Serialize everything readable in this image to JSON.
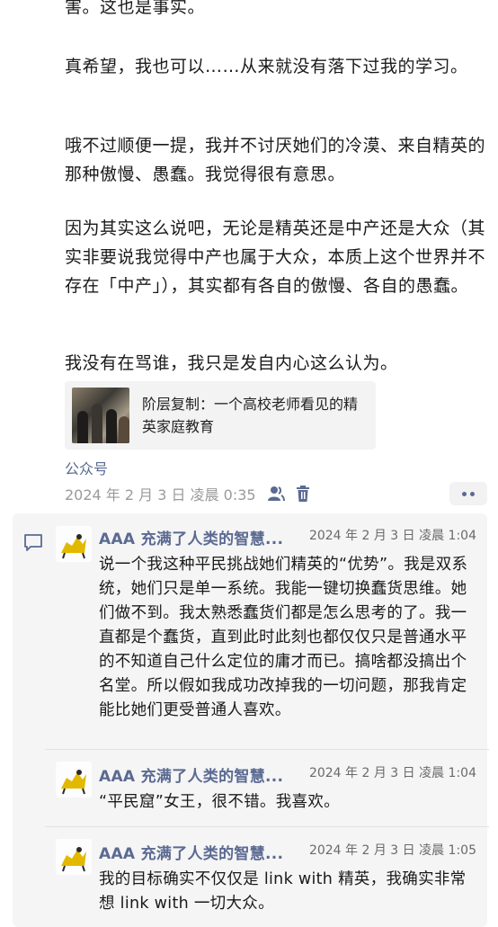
{
  "post": {
    "paragraphs": [
      "害。这也是事实。",
      "真希望，我也可以……从来就没有落下过我的学习。",
      "哦不过顺便一提，我并不讨厌她们的冷漠、来自精英的那种傲慢、愚蠢。我觉得很有意思。",
      "因为其实这么说吧，无论是精英还是中产还是大众（其实非要说我觉得中产也属于大众，本质上这个世界并不存在「中产」），其实都有各自的傲慢、各自的愚蠢。",
      "我没有在骂谁，我只是发自内心这么认为。"
    ],
    "card_title": "阶层复制：一个高校老师看见的精英家庭教育",
    "source": "公众号",
    "timestamp": "2024 年 2 月 3 日 凌晨 0:35"
  },
  "comments": [
    {
      "author": "AAA 充满了人类的智慧...",
      "time": "2024 年 2 月 3 日 凌晨 1:04",
      "text": "说一个我这种平民挑战她们精英的“优势”。我是双系统，她们只是单一系统。我能一键切换蠢货思维。她们做不到。我太熟悉蠢货们都是怎么思考的了。我一直都是个蠢货，直到此时此刻也都仅仅只是普通水平的不知道自己什么定位的庸才而已。搞啥都没搞出个名堂。所以假如我成功改掉我的一切问题，那我肯定能比她们更受普通人喜欢。"
    },
    {
      "author": "AAA 充满了人类的智慧...",
      "time": "2024 年 2 月 3 日 凌晨 1:04",
      "text": "“平民窟”女王，很不错。我喜欢。"
    },
    {
      "author": "AAA 充满了人类的智慧...",
      "time": "2024 年 2 月 3 日 凌晨 1:05",
      "text": "我的目标确实不仅仅是 link with 精英，我确实非常想 link with 一切大众。"
    }
  ],
  "colors": {
    "link": "#5b6a92",
    "meta": "#9a9a9a",
    "comment_bg": "#f5f5f5"
  }
}
